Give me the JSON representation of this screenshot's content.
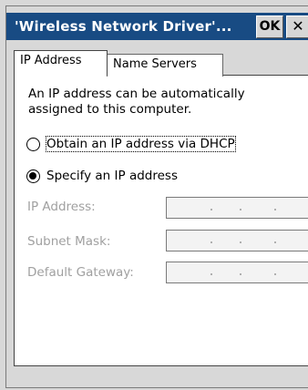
{
  "window": {
    "title": "'Wireless Network Driver'...",
    "ok_label": "OK",
    "close_label": "✕"
  },
  "tabs": [
    {
      "label": "IP Address",
      "selected": true
    },
    {
      "label": "Name Servers",
      "selected": false
    }
  ],
  "content": {
    "intro": "An IP address can be automatically assigned to this computer.",
    "radio_dhcp": {
      "label": "Obtain an IP address via DHCP",
      "checked": false
    },
    "radio_specify": {
      "label": "Specify an IP address",
      "checked": true
    },
    "fields": [
      {
        "label": "IP Address:",
        "value": ".        .        .",
        "enabled": false
      },
      {
        "label": "Subnet Mask:",
        "value": ".        .        .",
        "enabled": false
      },
      {
        "label": "Default Gateway:",
        "value": ".        .        .",
        "enabled": false
      }
    ]
  },
  "colors": {
    "titlebar": "#184b83",
    "disabled_text": "#a0a0a0"
  }
}
